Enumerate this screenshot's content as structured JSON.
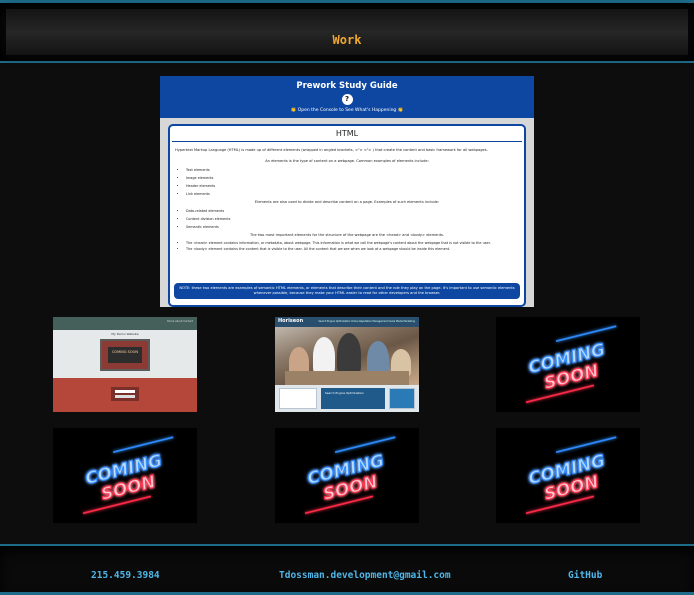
{
  "header": {
    "title": "Work"
  },
  "featured": {
    "title": "Prework Study Guide",
    "logo_char": "?",
    "subtitle": "👏 Open the Console to See What's Happening 👏",
    "card_title": "HTML",
    "p1": "Hypertext Markup Language (HTML) is made up of different elements (wrapped in angled brackets, <\"> <\"> ) that create the content and basic framework for all webpages.",
    "p2": "An elements is the type of content on a webpage. Common examples of elements include:",
    "list1": [
      "Text elements",
      "Image elements",
      "Header elements",
      "Link elements"
    ],
    "p3": "Elements are also used to divide and describe content on a page. Examples of such elements include:",
    "list2": [
      "Data-related elements",
      "Content division elements",
      "Semantic elements"
    ],
    "p4": "The two most important elements for the structure of the webpage are the <head> and <body> elements.",
    "list3": [
      "The <head> element contains information, or metadata, about webpage. This information is what we call the webpage's content about the webpage that is not visible to the user.",
      "The <body> element contains the content that is visible to the user. All the content that we see when we look at a webpage should be inside this element."
    ],
    "note": "NOTE: these two elements are examples of semantic HTML elements, or elements that describe their content and the role they play on the page. It's important to use semantic elements whenever possible, because they make your HTML easier to read for other developers and the browser."
  },
  "thumbs": {
    "portfolio": {
      "site_name": "My Demo Website",
      "nav": "Home   About   Contact",
      "frame_text": "COMING SOON"
    },
    "horiseon": {
      "brand": "Horiseon",
      "nav": "Search Engine Optimization   Online Reputation Management   Social Media Marketing",
      "feature_text": "Search Engine Optimization"
    },
    "coming_soon": {
      "line1": "COMING",
      "line2": "SOON"
    }
  },
  "footer": {
    "phone": "215.459.3984",
    "email": "Tdossman.development@gmail.com",
    "github": "GitHub"
  },
  "colors": {
    "accent_title": "#f0a830",
    "link": "#4fb6e8",
    "border": "#1e6c8a",
    "neon_blue": "#2f8cff",
    "neon_red": "#ff2a4a"
  }
}
